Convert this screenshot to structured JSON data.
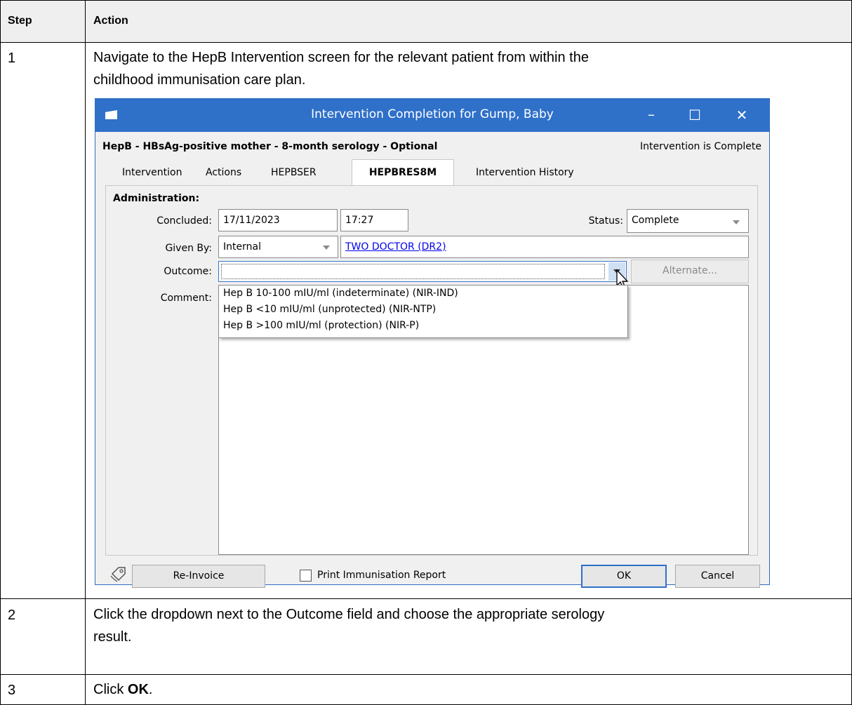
{
  "table": {
    "headers": [
      "Step",
      "Action"
    ],
    "rows": [
      {
        "step": "1",
        "action_lines": [
          "Navigate to the HepB Intervention screen for the relevant patient from within the",
          "childhood immunisation care plan."
        ]
      },
      {
        "step": "2",
        "action_lines": [
          "Click the dropdown next to the Outcome field and choose the appropriate serology",
          "result."
        ]
      },
      {
        "step": "3",
        "action_prefix": "Click ",
        "action_bold": "OK",
        "action_suffix": "."
      }
    ]
  },
  "dialog": {
    "title": "Intervention Completion for Gump, Baby",
    "window_buttons": {
      "minimize": "–",
      "maximize": "☐",
      "close": "✕"
    },
    "heading": "HepB - HBsAg-positive mother - 8-month serology - Optional",
    "status_text": "Intervention is Complete",
    "tabs": [
      "Intervention",
      "Actions",
      "HEPBSER",
      "HEPBRES8M",
      "Intervention History"
    ],
    "active_tab": "HEPBRES8M",
    "section_label": "Administration:",
    "concluded": {
      "label": "Concluded:",
      "date": "17/11/2023",
      "time": "17:27"
    },
    "status": {
      "label": "Status:",
      "value": "Complete"
    },
    "given_by": {
      "label": "Given By:",
      "value": "Internal",
      "link": "TWO DOCTOR (DR2)"
    },
    "outcome": {
      "label": "Outcome:",
      "value": "",
      "alternate_button": "Alternate...",
      "options": [
        "Hep B 10-100 mIU/ml (indeterminate) (NIR-IND)",
        "Hep B <10 mIU/ml (unprotected) (NIR-NTP)",
        "Hep B >100 mIU/ml (protection) (NIR-P)"
      ]
    },
    "comment": {
      "label": "Comment:"
    },
    "footer": {
      "reinvoice": "Re-Invoice",
      "print_checkbox": "Print Immunisation Report",
      "ok": "OK",
      "cancel": "Cancel"
    }
  },
  "colors": {
    "titlebar": "#2f70c9",
    "link": "#0000ee",
    "header_bg": "#efefef"
  }
}
